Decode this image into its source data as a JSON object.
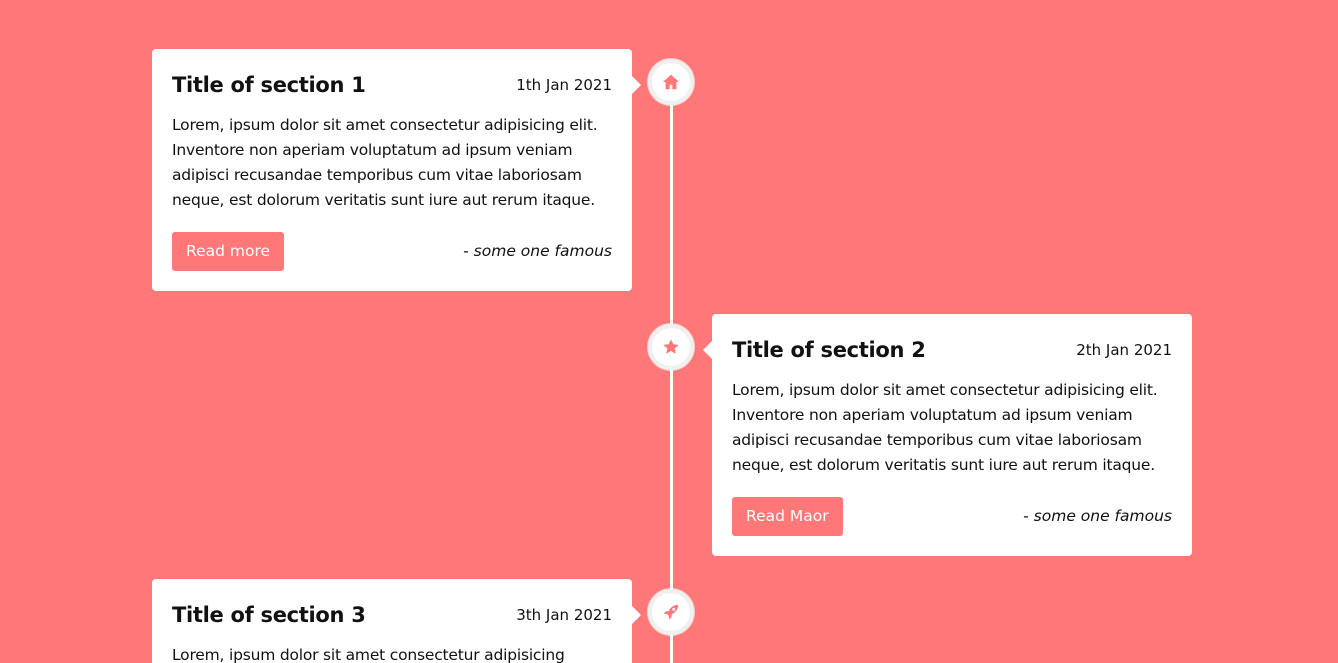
{
  "colors": {
    "background": "#ff7878",
    "card": "#ffffff",
    "accent": "#ff7878",
    "line": "#ffffff"
  },
  "sections": [
    {
      "title": "Title of section 1",
      "date": "1th Jan 2021",
      "text": "Lorem, ipsum dolor sit amet consectetur adipisicing elit. Inventore non aperiam voluptatum ad ipsum veniam adipisci recusandae temporibus cum vitae laboriosam neque, est dolorum veritatis sunt iure aut rerum itaque.",
      "button": "Read more",
      "quote": "- some one famous",
      "icon": "home-icon"
    },
    {
      "title": "Title of section 2",
      "date": "2th Jan 2021",
      "text": "Lorem, ipsum dolor sit amet consectetur adipisicing elit. Inventore non aperiam voluptatum ad ipsum veniam adipisci recusandae temporibus cum vitae laboriosam neque, est dolorum veritatis sunt iure aut rerum itaque.",
      "button": "Read Maor",
      "quote": "- some one famous",
      "icon": "star-icon"
    },
    {
      "title": "Title of section 3",
      "date": "3th Jan 2021",
      "text": "Lorem, ipsum dolor sit amet consectetur adipisicing",
      "icon": "rocket-icon"
    }
  ]
}
